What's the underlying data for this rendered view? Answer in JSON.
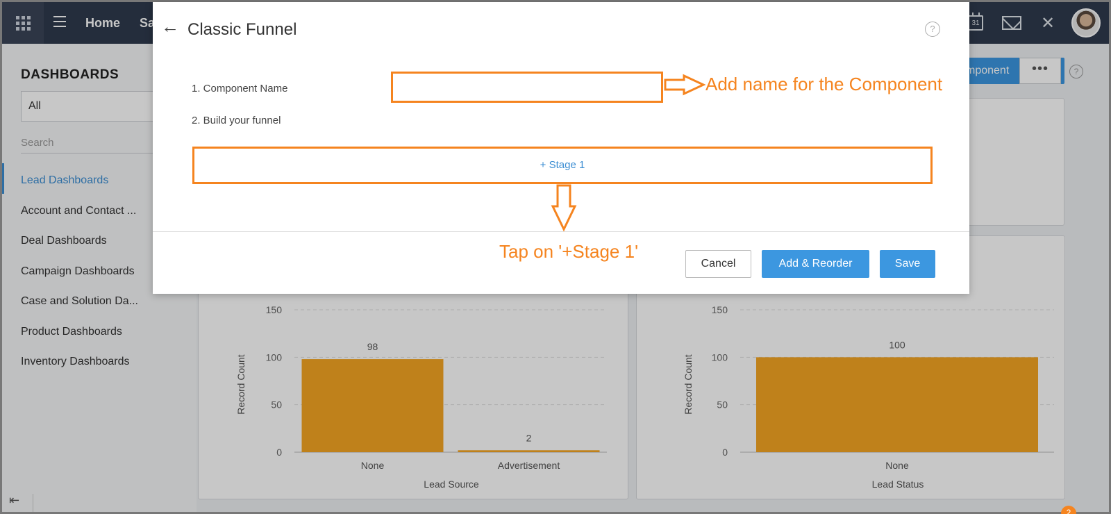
{
  "nav": {
    "home_label": "Home",
    "sales_label": "Sa",
    "icons": [
      "calendar-icon",
      "mail-icon",
      "tools-icon"
    ],
    "calendar_day": "31"
  },
  "sidebar": {
    "title": "DASHBOARDS",
    "filter_value": "All",
    "search_placeholder": "Search",
    "items": [
      {
        "label": "Lead Dashboards",
        "active": true
      },
      {
        "label": "Account and Contact ..."
      },
      {
        "label": "Deal Dashboards"
      },
      {
        "label": "Campaign Dashboards"
      },
      {
        "label": "Case and Solution Da..."
      },
      {
        "label": "Product Dashboards"
      },
      {
        "label": "Inventory Dashboards"
      }
    ],
    "collapse_glyph": "⇤"
  },
  "main": {
    "add_component_label": "mponent",
    "more_label": "•••",
    "help_label": "?"
  },
  "modal": {
    "back_glyph": "←",
    "title": "Classic Funnel",
    "help_label": "?",
    "component_name_label": "1. Component Name",
    "build_funnel_label": "2. Build your funnel",
    "stage_label": "+ Stage 1",
    "cancel_label": "Cancel",
    "add_reorder_label": "Add & Reorder",
    "save_label": "Save"
  },
  "annotations": {
    "name_hint": "Add name for the Component",
    "stage_hint": "Tap on '+Stage 1'"
  },
  "badge_label": "2",
  "colors": {
    "accent": "#3c97e0",
    "annotation": "#f5841f",
    "bar": "#f5a623",
    "nav_bg": "#2f3a4d"
  },
  "chart_data": [
    {
      "type": "bar",
      "categories": [
        "None",
        "Advertisement"
      ],
      "values": [
        98,
        2
      ],
      "xlabel": "Lead Source",
      "ylabel": "Record Count",
      "yticks": [
        0,
        50,
        100,
        150
      ],
      "ylim": [
        0,
        150
      ],
      "color": "#f5a623"
    },
    {
      "type": "bar",
      "categories": [
        "None"
      ],
      "values": [
        100
      ],
      "xlabel": "Lead Status",
      "ylabel": "Record Count",
      "yticks": [
        0,
        50,
        100,
        150
      ],
      "ylim": [
        0,
        150
      ],
      "color": "#f5a623"
    }
  ]
}
